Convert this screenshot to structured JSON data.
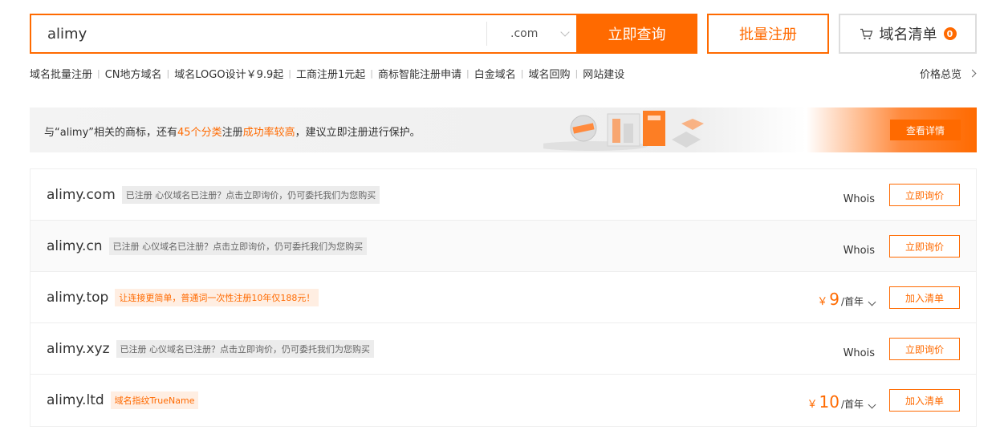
{
  "search": {
    "value": "alimy",
    "suffix": ".com",
    "button": "立即查询"
  },
  "bulk_register": "批量注册",
  "cart": {
    "label": "域名清单",
    "count": "0"
  },
  "quick_links": [
    "域名批量注册",
    "CN地方域名",
    "域名LOGO设计￥9.9起",
    "工商注册1元起",
    "商标智能注册申请",
    "白金域名",
    "域名回购",
    "网站建设"
  ],
  "price_overview": "价格总览",
  "banner": {
    "text_prefix": "与“alimy”相关的商标，还有",
    "text_hl1": "45个分类",
    "text_mid": "注册",
    "text_hl2": "成功率较高",
    "text_suffix": "，建议立即注册进行保护。",
    "button": "查看详情"
  },
  "results": [
    {
      "domain": "alimy.com",
      "tag": "已注册 心仪域名已注册？点击立即询价，仍可委托我们为您购买",
      "tag_style": "gray",
      "whois": "Whois",
      "action": "立即询价"
    },
    {
      "domain": "alimy.cn",
      "tag": "已注册 心仪域名已注册？点击立即询价，仍可委托我们为您购买",
      "tag_style": "gray",
      "whois": "Whois",
      "action": "立即询价"
    },
    {
      "domain": "alimy.top",
      "tag": "让连接更简单，普通词一次性注册10年仅188元！",
      "tag_style": "orange",
      "currency": "￥",
      "price": "9",
      "unit": "/首年",
      "action": "加入清单"
    },
    {
      "domain": "alimy.xyz",
      "tag": "已注册 心仪域名已注册？点击立即询价，仍可委托我们为您购买",
      "tag_style": "gray",
      "whois": "Whois",
      "action": "立即询价"
    },
    {
      "domain": "alimy.ltd",
      "tag": "域名指纹TrueName",
      "tag_style": "orange",
      "currency": "￥",
      "price": "10",
      "unit": "/首年",
      "action": "加入清单"
    }
  ],
  "colors": {
    "accent": "#ff6a00"
  }
}
